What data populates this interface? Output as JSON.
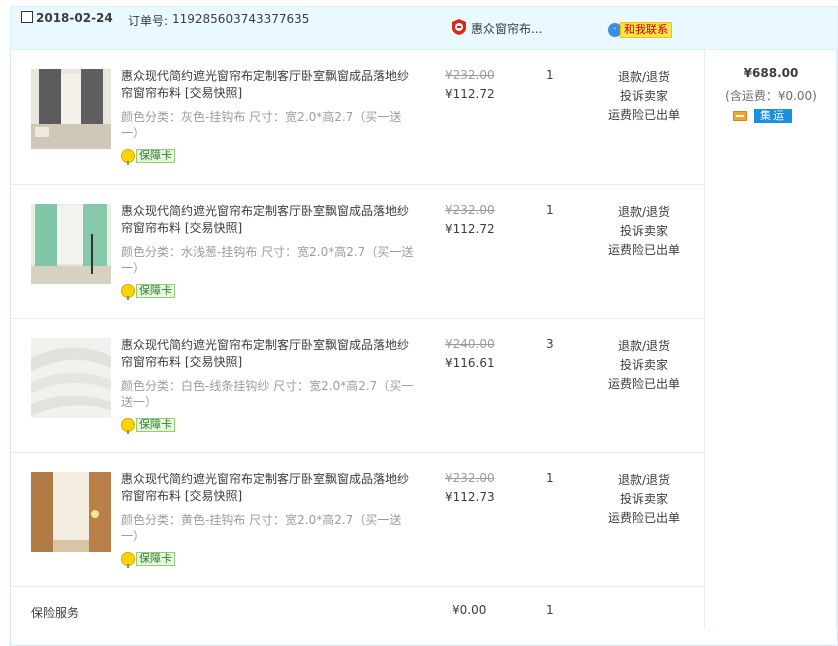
{
  "order": {
    "date": "2018-02-24",
    "order_no_label": "订单号:",
    "order_no": "119285603743377635",
    "shop_name": "惠众窗帘布...",
    "contact_label": "和我联系"
  },
  "items": [
    {
      "title": "惠众现代简约遮光窗帘布定制客厅卧室飘窗成品落地纱帘窗帘布料 [交易快照]",
      "spec": "颜色分类：灰色-挂钩布  尺寸：宽2.0*高2.7（买一送一）",
      "guarantee": "保障卡",
      "original_price": "¥232.00",
      "price": "¥112.72",
      "quantity": "1",
      "actions": [
        "退款/退货",
        "投诉卖家",
        "运费险已出单"
      ]
    },
    {
      "title": "惠众现代简约遮光窗帘布定制客厅卧室飘窗成品落地纱帘窗帘布料 [交易快照]",
      "spec": "颜色分类：水浅葱-挂钩布  尺寸：宽2.0*高2.7（买一送一）",
      "guarantee": "保障卡",
      "original_price": "¥232.00",
      "price": "¥112.72",
      "quantity": "1",
      "actions": [
        "退款/退货",
        "投诉卖家",
        "运费险已出单"
      ]
    },
    {
      "title": "惠众现代简约遮光窗帘布定制客厅卧室飘窗成品落地纱帘窗帘布料 [交易快照]",
      "spec": "颜色分类：白色-线条挂钩纱  尺寸：宽2.0*高2.7（买一送一）",
      "guarantee": "保障卡",
      "original_price": "¥240.00",
      "price": "¥116.61",
      "quantity": "3",
      "actions": [
        "退款/退货",
        "投诉卖家",
        "运费险已出单"
      ]
    },
    {
      "title": "惠众现代简约遮光窗帘布定制客厅卧室飘窗成品落地纱帘窗帘布料 [交易快照]",
      "spec": "颜色分类：黄色-挂钩布  尺寸：宽2.0*高2.7（买一送一）",
      "guarantee": "保障卡",
      "original_price": "¥232.00",
      "price": "¥112.73",
      "quantity": "1",
      "actions": [
        "退款/退货",
        "投诉卖家",
        "运费险已出单"
      ]
    }
  ],
  "summary": {
    "total": "¥688.00",
    "shipping": "(含运费：¥0.00)",
    "jiyun_label": "集运"
  },
  "insurance": {
    "label": "保险服务",
    "price": "¥0.00",
    "quantity": "1"
  }
}
